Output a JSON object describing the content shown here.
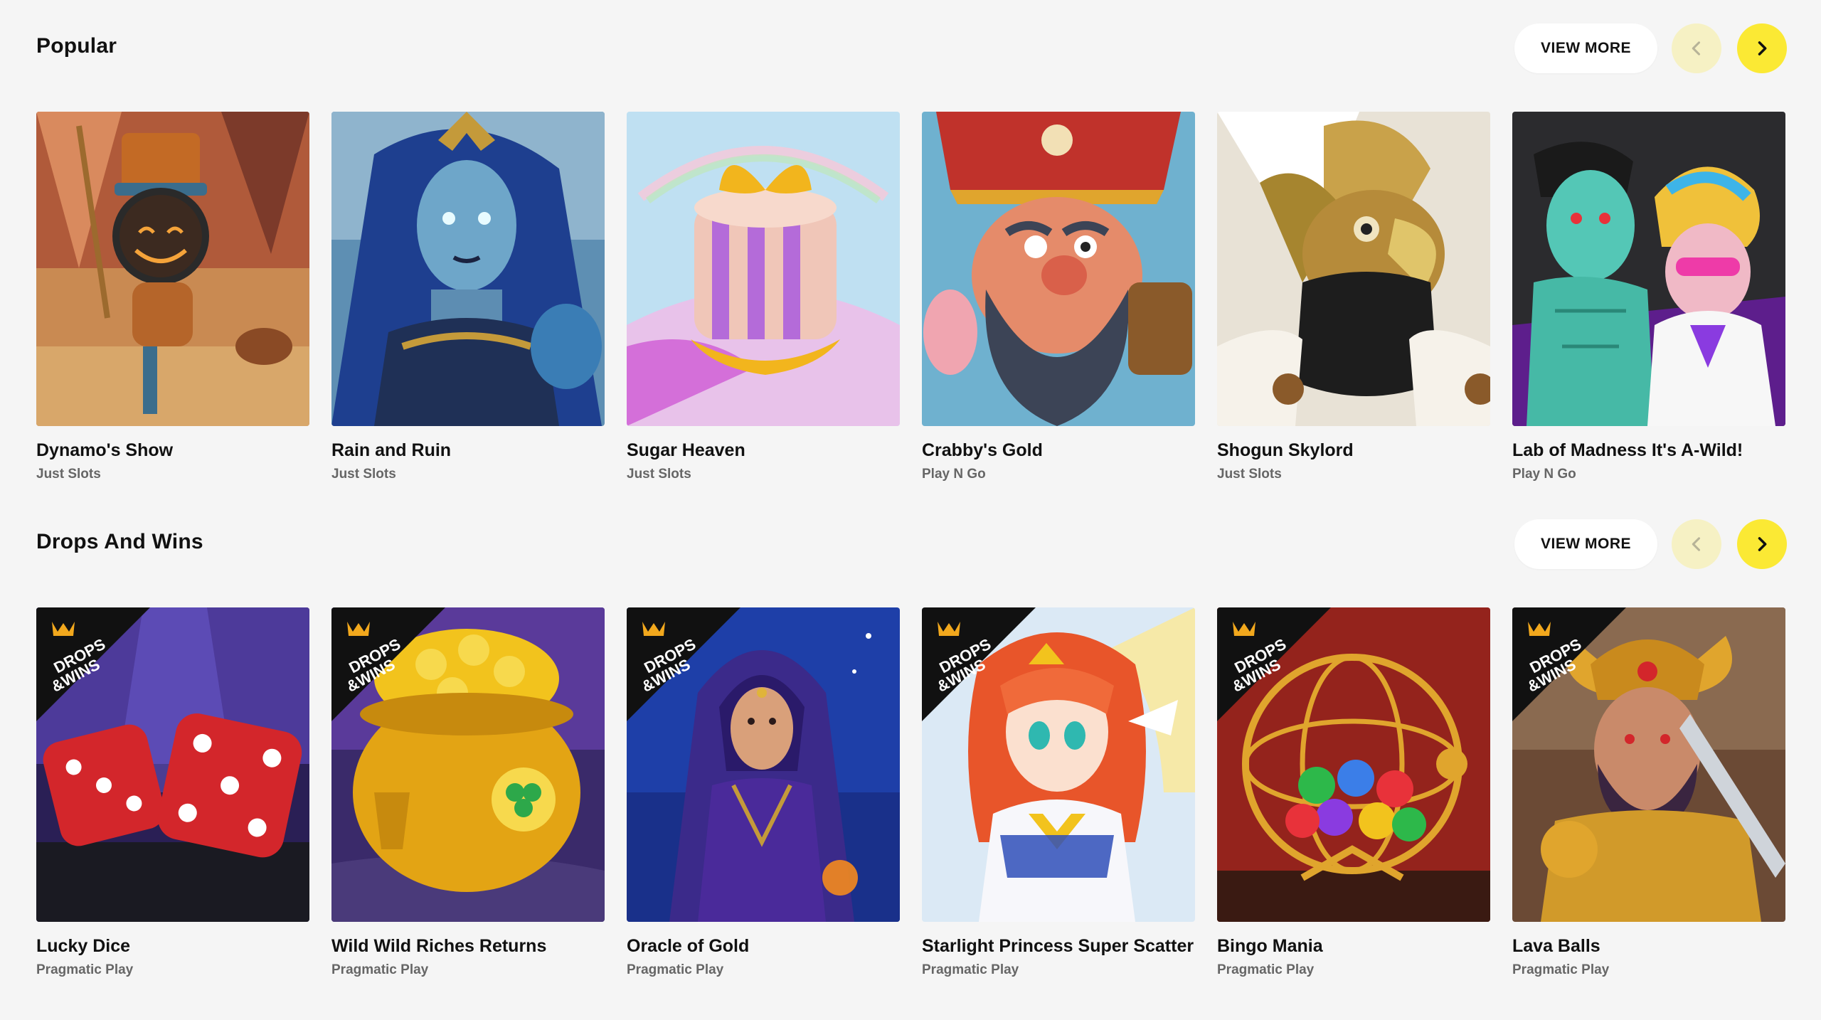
{
  "sections": [
    {
      "title": "Popular",
      "view_more_label": "VIEW MORE",
      "games": [
        {
          "title": "Dynamo's Show",
          "provider": "Just Slots",
          "art": "robot-clown"
        },
        {
          "title": "Rain and Ruin",
          "provider": "Just Slots",
          "art": "blue-warrior-woman"
        },
        {
          "title": "Sugar Heaven",
          "provider": "Just Slots",
          "art": "gift-box"
        },
        {
          "title": "Crabby's Gold",
          "provider": "Play N Go",
          "art": "pirate"
        },
        {
          "title": "Shogun Skylord",
          "provider": "Just Slots",
          "art": "eagle-warrior"
        },
        {
          "title": "Lab of Madness It's A-Wild!",
          "provider": "Play N Go",
          "art": "mad-scientists"
        }
      ]
    },
    {
      "title": "Drops And Wins",
      "view_more_label": "VIEW MORE",
      "badge_text": "DROPS &WINS",
      "games": [
        {
          "title": "Lucky Dice",
          "provider": "Pragmatic Play",
          "art": "dice"
        },
        {
          "title": "Wild Wild Riches Returns",
          "provider": "Pragmatic Play",
          "art": "pot-of-gold"
        },
        {
          "title": "Oracle of Gold",
          "provider": "Pragmatic Play",
          "art": "sorceress"
        },
        {
          "title": "Starlight Princess Super Scatter",
          "provider": "Pragmatic Play",
          "art": "anime-princess"
        },
        {
          "title": "Bingo Mania",
          "provider": "Pragmatic Play",
          "art": "bingo-cage"
        },
        {
          "title": "Lava Balls",
          "provider": "Pragmatic Play",
          "art": "horned-warrior"
        }
      ]
    }
  ],
  "colors": {
    "page_bg": "#f5f5f5",
    "accent_yellow": "#fbe934",
    "accent_yellow_disabled": "#f6f1c4",
    "title_text": "#111111",
    "provider_text": "#666666"
  }
}
